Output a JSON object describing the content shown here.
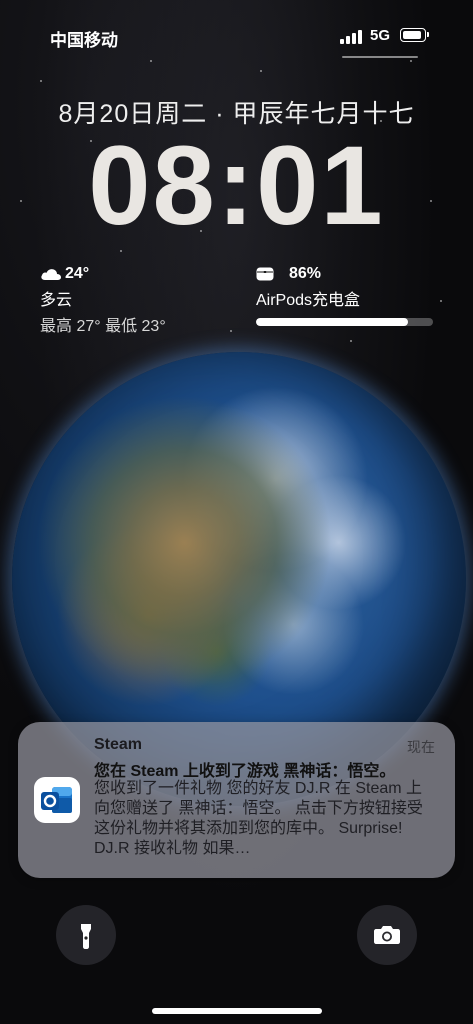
{
  "status_bar": {
    "carrier": "中国移动",
    "network": "5G"
  },
  "lockscreen": {
    "date": "8月20日周二 · 甲辰年七月十七",
    "time": "08:01"
  },
  "weather_widget": {
    "icon": "cloud-icon",
    "temperature": "24°",
    "condition": "多云",
    "high_low": "最高 27° 最低 23°"
  },
  "airpods_widget": {
    "icon": "airpods-case-icon",
    "percent": "86%",
    "battery_level": 0.86,
    "name": "AirPods充电盒"
  },
  "notification": {
    "app": "Steam",
    "time": "现在",
    "icon": "outlook-icon",
    "title": "您在 Steam 上收到了游戏 黑神话：悟空。",
    "body": "您收到了一件礼物 您的好友 DJ.R 在 Steam 上向您赠送了 黑神话：悟空。 点击下方按钮接受这份礼物并将其添加到您的库中。 Surprise! DJ.R 接收礼物 如果…"
  },
  "controls": {
    "flashlight_icon": "flashlight-icon",
    "camera_icon": "camera-icon"
  }
}
